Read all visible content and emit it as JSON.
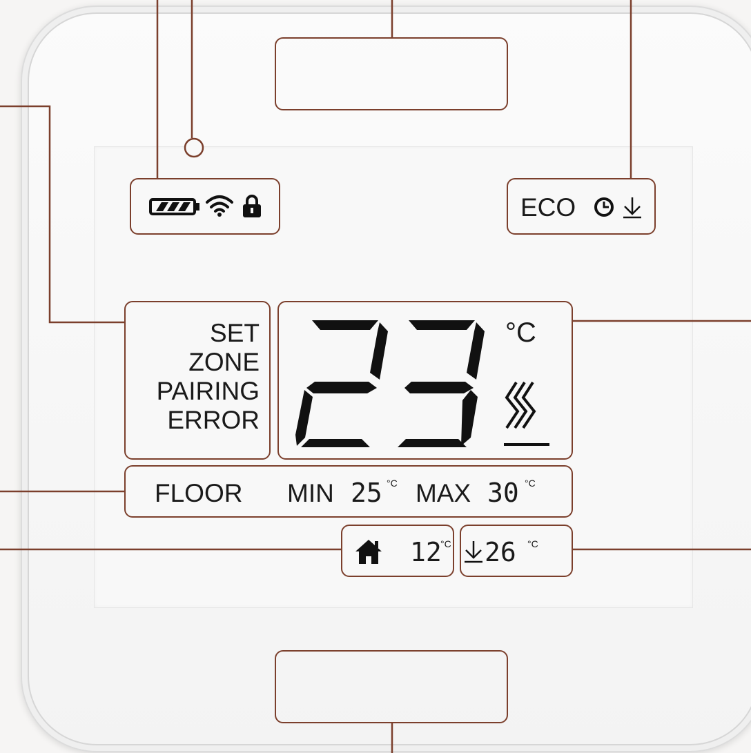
{
  "top_bar": {
    "eco_label": "ECO"
  },
  "mode_labels": [
    "SET",
    "ZONE",
    "PAIRING",
    "ERROR"
  ],
  "main_display": {
    "temperature": "23",
    "unit": "°C"
  },
  "floor_bar": {
    "floor_label": "FLOOR",
    "min_label": "MIN",
    "min_value": "25",
    "min_unit": "°C",
    "max_label": "MAX",
    "max_value": "30",
    "max_unit": "°C"
  },
  "bottom_bar": {
    "home_value": "12",
    "home_unit": "°C",
    "setback_value": "26",
    "setback_unit": "°C"
  },
  "icons": {
    "battery": "battery-icon",
    "wifi": "wifi-icon",
    "lock": "lock-icon",
    "clock": "clock-icon",
    "setback": "down-arrow-icon",
    "heating": "heating-icon",
    "home": "home-icon"
  },
  "colors": {
    "callout": "#7b3f2c",
    "segment": "#111111"
  }
}
